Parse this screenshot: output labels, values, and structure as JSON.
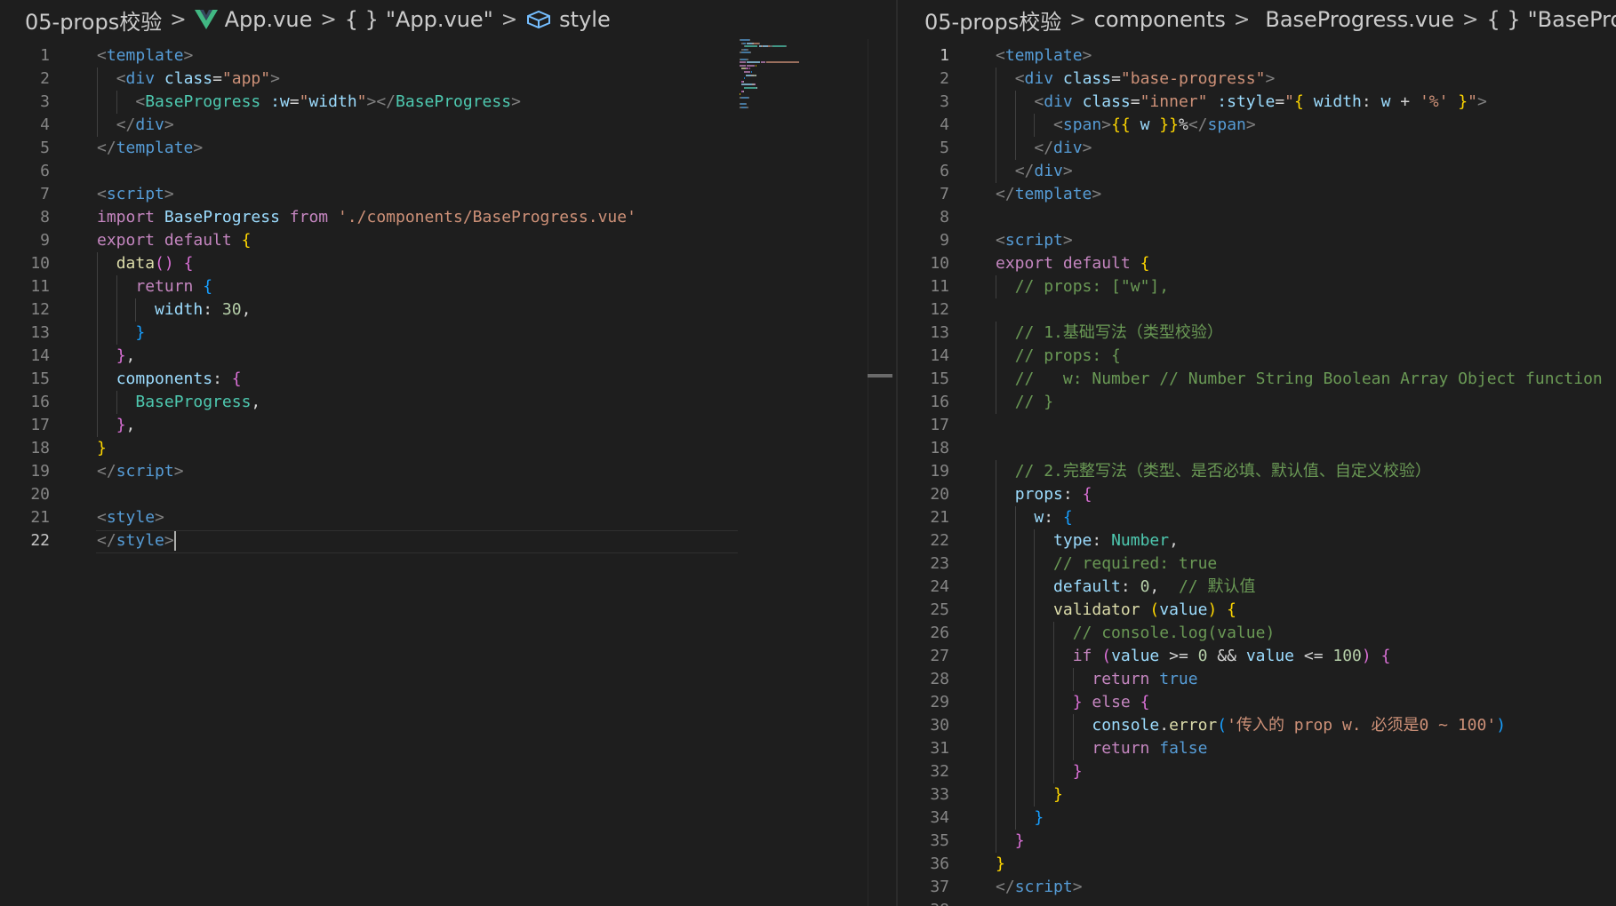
{
  "left_editor": {
    "breadcrumb": {
      "folder": "05-props校验",
      "file": "App.vue",
      "object": "\"App.vue\"",
      "symbol": "style"
    },
    "active_line": 22,
    "lines": [
      [
        {
          "c": "t-punct",
          "t": "<"
        },
        {
          "c": "t-tag",
          "t": "template"
        },
        {
          "c": "t-punct",
          "t": ">"
        }
      ],
      [
        {
          "c": "t-plain",
          "t": "  "
        },
        {
          "c": "t-punct",
          "t": "<"
        },
        {
          "c": "t-tag",
          "t": "div"
        },
        {
          "c": "t-plain",
          "t": " "
        },
        {
          "c": "t-attr",
          "t": "class"
        },
        {
          "c": "t-plain",
          "t": "="
        },
        {
          "c": "t-str",
          "t": "\"app\""
        },
        {
          "c": "t-punct",
          "t": ">"
        }
      ],
      [
        {
          "c": "t-plain",
          "t": "    "
        },
        {
          "c": "t-punct",
          "t": "<"
        },
        {
          "c": "t-comp",
          "t": "BaseProgress"
        },
        {
          "c": "t-plain",
          "t": " "
        },
        {
          "c": "t-attr",
          "t": ":w"
        },
        {
          "c": "t-plain",
          "t": "="
        },
        {
          "c": "t-str",
          "t": "\""
        },
        {
          "c": "t-var",
          "t": "width"
        },
        {
          "c": "t-str",
          "t": "\""
        },
        {
          "c": "t-punct",
          "t": "></"
        },
        {
          "c": "t-comp",
          "t": "BaseProgress"
        },
        {
          "c": "t-punct",
          "t": ">"
        }
      ],
      [
        {
          "c": "t-plain",
          "t": "  "
        },
        {
          "c": "t-punct",
          "t": "</"
        },
        {
          "c": "t-tag",
          "t": "div"
        },
        {
          "c": "t-punct",
          "t": ">"
        }
      ],
      [
        {
          "c": "t-punct",
          "t": "</"
        },
        {
          "c": "t-tag",
          "t": "template"
        },
        {
          "c": "t-punct",
          "t": ">"
        }
      ],
      [],
      [
        {
          "c": "t-punct",
          "t": "<"
        },
        {
          "c": "t-tag",
          "t": "script"
        },
        {
          "c": "t-punct",
          "t": ">"
        }
      ],
      [
        {
          "c": "t-kw",
          "t": "import"
        },
        {
          "c": "t-plain",
          "t": " "
        },
        {
          "c": "t-var",
          "t": "BaseProgress"
        },
        {
          "c": "t-plain",
          "t": " "
        },
        {
          "c": "t-kw",
          "t": "from"
        },
        {
          "c": "t-plain",
          "t": " "
        },
        {
          "c": "t-str",
          "t": "'./components/BaseProgress.vue'"
        }
      ],
      [
        {
          "c": "t-kw",
          "t": "export"
        },
        {
          "c": "t-plain",
          "t": " "
        },
        {
          "c": "t-kw",
          "t": "default"
        },
        {
          "c": "t-plain",
          "t": " "
        },
        {
          "c": "t-b1",
          "t": "{"
        }
      ],
      [
        {
          "c": "t-plain",
          "t": "  "
        },
        {
          "c": "t-fn",
          "t": "data"
        },
        {
          "c": "t-b2",
          "t": "()"
        },
        {
          "c": "t-plain",
          "t": " "
        },
        {
          "c": "t-b2",
          "t": "{"
        }
      ],
      [
        {
          "c": "t-plain",
          "t": "    "
        },
        {
          "c": "t-kw",
          "t": "return"
        },
        {
          "c": "t-plain",
          "t": " "
        },
        {
          "c": "t-b3",
          "t": "{"
        }
      ],
      [
        {
          "c": "t-plain",
          "t": "      "
        },
        {
          "c": "t-var",
          "t": "width"
        },
        {
          "c": "t-plain",
          "t": ": "
        },
        {
          "c": "t-num",
          "t": "30"
        },
        {
          "c": "t-plain",
          "t": ","
        }
      ],
      [
        {
          "c": "t-plain",
          "t": "    "
        },
        {
          "c": "t-b3",
          "t": "}"
        }
      ],
      [
        {
          "c": "t-plain",
          "t": "  "
        },
        {
          "c": "t-b2",
          "t": "}"
        },
        {
          "c": "t-plain",
          "t": ","
        }
      ],
      [
        {
          "c": "t-plain",
          "t": "  "
        },
        {
          "c": "t-var",
          "t": "components"
        },
        {
          "c": "t-plain",
          "t": ": "
        },
        {
          "c": "t-b2",
          "t": "{"
        }
      ],
      [
        {
          "c": "t-plain",
          "t": "    "
        },
        {
          "c": "t-comp",
          "t": "BaseProgress"
        },
        {
          "c": "t-plain",
          "t": ","
        }
      ],
      [
        {
          "c": "t-plain",
          "t": "  "
        },
        {
          "c": "t-b2",
          "t": "}"
        },
        {
          "c": "t-plain",
          "t": ","
        }
      ],
      [
        {
          "c": "t-b1",
          "t": "}"
        }
      ],
      [
        {
          "c": "t-punct",
          "t": "</"
        },
        {
          "c": "t-tag",
          "t": "script"
        },
        {
          "c": "t-punct",
          "t": ">"
        }
      ],
      [],
      [
        {
          "c": "t-punct",
          "t": "<"
        },
        {
          "c": "t-tag",
          "t": "style"
        },
        {
          "c": "t-punct",
          "t": ">"
        }
      ],
      [
        {
          "c": "t-punct",
          "t": "</"
        },
        {
          "c": "t-tag",
          "t": "style"
        },
        {
          "c": "t-punct",
          "t": ">"
        }
      ]
    ]
  },
  "right_editor": {
    "breadcrumb": {
      "folder": "05-props校验",
      "subfolder": "components",
      "file": "BaseProgress.vue",
      "object": "\"BasePro"
    },
    "active_line": 1,
    "lines": [
      [
        {
          "c": "t-punct",
          "t": "<"
        },
        {
          "c": "t-tag",
          "t": "template"
        },
        {
          "c": "t-punct",
          "t": ">"
        }
      ],
      [
        {
          "c": "t-plain",
          "t": "  "
        },
        {
          "c": "t-punct",
          "t": "<"
        },
        {
          "c": "t-tag",
          "t": "div"
        },
        {
          "c": "t-plain",
          "t": " "
        },
        {
          "c": "t-attr",
          "t": "class"
        },
        {
          "c": "t-plain",
          "t": "="
        },
        {
          "c": "t-str",
          "t": "\"base-progress\""
        },
        {
          "c": "t-punct",
          "t": ">"
        }
      ],
      [
        {
          "c": "t-plain",
          "t": "    "
        },
        {
          "c": "t-punct",
          "t": "<"
        },
        {
          "c": "t-tag",
          "t": "div"
        },
        {
          "c": "t-plain",
          "t": " "
        },
        {
          "c": "t-attr",
          "t": "class"
        },
        {
          "c": "t-plain",
          "t": "="
        },
        {
          "c": "t-str",
          "t": "\"inner\""
        },
        {
          "c": "t-plain",
          "t": " "
        },
        {
          "c": "t-attr",
          "t": ":style"
        },
        {
          "c": "t-plain",
          "t": "="
        },
        {
          "c": "t-str",
          "t": "\""
        },
        {
          "c": "t-b1",
          "t": "{"
        },
        {
          "c": "t-plain",
          "t": " "
        },
        {
          "c": "t-var",
          "t": "width"
        },
        {
          "c": "t-plain",
          "t": ": "
        },
        {
          "c": "t-var",
          "t": "w"
        },
        {
          "c": "t-plain",
          "t": " + "
        },
        {
          "c": "t-str",
          "t": "'%'"
        },
        {
          "c": "t-plain",
          "t": " "
        },
        {
          "c": "t-b1",
          "t": "}"
        },
        {
          "c": "t-str",
          "t": "\""
        },
        {
          "c": "t-punct",
          "t": ">"
        }
      ],
      [
        {
          "c": "t-plain",
          "t": "      "
        },
        {
          "c": "t-punct",
          "t": "<"
        },
        {
          "c": "t-tag",
          "t": "span"
        },
        {
          "c": "t-punct",
          "t": ">"
        },
        {
          "c": "t-b1",
          "t": "{{"
        },
        {
          "c": "t-plain",
          "t": " "
        },
        {
          "c": "t-var",
          "t": "w"
        },
        {
          "c": "t-plain",
          "t": " "
        },
        {
          "c": "t-b1",
          "t": "}}"
        },
        {
          "c": "t-plain",
          "t": "%"
        },
        {
          "c": "t-punct",
          "t": "</"
        },
        {
          "c": "t-tag",
          "t": "span"
        },
        {
          "c": "t-punct",
          "t": ">"
        }
      ],
      [
        {
          "c": "t-plain",
          "t": "    "
        },
        {
          "c": "t-punct",
          "t": "</"
        },
        {
          "c": "t-tag",
          "t": "div"
        },
        {
          "c": "t-punct",
          "t": ">"
        }
      ],
      [
        {
          "c": "t-plain",
          "t": "  "
        },
        {
          "c": "t-punct",
          "t": "</"
        },
        {
          "c": "t-tag",
          "t": "div"
        },
        {
          "c": "t-punct",
          "t": ">"
        }
      ],
      [
        {
          "c": "t-punct",
          "t": "</"
        },
        {
          "c": "t-tag",
          "t": "template"
        },
        {
          "c": "t-punct",
          "t": ">"
        }
      ],
      [],
      [
        {
          "c": "t-punct",
          "t": "<"
        },
        {
          "c": "t-tag",
          "t": "script"
        },
        {
          "c": "t-punct",
          "t": ">"
        }
      ],
      [
        {
          "c": "t-kw",
          "t": "export"
        },
        {
          "c": "t-plain",
          "t": " "
        },
        {
          "c": "t-kw",
          "t": "default"
        },
        {
          "c": "t-plain",
          "t": " "
        },
        {
          "c": "t-b1",
          "t": "{"
        }
      ],
      [
        {
          "c": "t-plain",
          "t": "  "
        },
        {
          "c": "t-com",
          "t": "// props: [\"w\"],"
        }
      ],
      [],
      [
        {
          "c": "t-plain",
          "t": "  "
        },
        {
          "c": "t-com",
          "t": "// 1.基础写法（类型校验）"
        }
      ],
      [
        {
          "c": "t-plain",
          "t": "  "
        },
        {
          "c": "t-com",
          "t": "// props: {"
        }
      ],
      [
        {
          "c": "t-plain",
          "t": "  "
        },
        {
          "c": "t-com",
          "t": "//   w: Number // Number String Boolean Array Object function"
        }
      ],
      [
        {
          "c": "t-plain",
          "t": "  "
        },
        {
          "c": "t-com",
          "t": "// }"
        }
      ],
      [],
      [],
      [
        {
          "c": "t-plain",
          "t": "  "
        },
        {
          "c": "t-com",
          "t": "// 2.完整写法（类型、是否必填、默认值、自定义校验）"
        }
      ],
      [
        {
          "c": "t-plain",
          "t": "  "
        },
        {
          "c": "t-var",
          "t": "props"
        },
        {
          "c": "t-plain",
          "t": ": "
        },
        {
          "c": "t-b2",
          "t": "{"
        }
      ],
      [
        {
          "c": "t-plain",
          "t": "    "
        },
        {
          "c": "t-var",
          "t": "w"
        },
        {
          "c": "t-plain",
          "t": ": "
        },
        {
          "c": "t-b3",
          "t": "{"
        }
      ],
      [
        {
          "c": "t-plain",
          "t": "      "
        },
        {
          "c": "t-var",
          "t": "type"
        },
        {
          "c": "t-plain",
          "t": ": "
        },
        {
          "c": "t-comp",
          "t": "Number"
        },
        {
          "c": "t-plain",
          "t": ","
        }
      ],
      [
        {
          "c": "t-plain",
          "t": "      "
        },
        {
          "c": "t-com",
          "t": "// required: true"
        }
      ],
      [
        {
          "c": "t-plain",
          "t": "      "
        },
        {
          "c": "t-var",
          "t": "default"
        },
        {
          "c": "t-plain",
          "t": ": "
        },
        {
          "c": "t-num",
          "t": "0"
        },
        {
          "c": "t-plain",
          "t": ",  "
        },
        {
          "c": "t-com",
          "t": "// 默认值"
        }
      ],
      [
        {
          "c": "t-plain",
          "t": "      "
        },
        {
          "c": "t-fn",
          "t": "validator"
        },
        {
          "c": "t-plain",
          "t": " "
        },
        {
          "c": "t-b1",
          "t": "("
        },
        {
          "c": "t-var",
          "t": "value"
        },
        {
          "c": "t-b1",
          "t": ")"
        },
        {
          "c": "t-plain",
          "t": " "
        },
        {
          "c": "t-b1",
          "t": "{"
        }
      ],
      [
        {
          "c": "t-plain",
          "t": "        "
        },
        {
          "c": "t-com",
          "t": "// console.log(value)"
        }
      ],
      [
        {
          "c": "t-plain",
          "t": "        "
        },
        {
          "c": "t-kw",
          "t": "if"
        },
        {
          "c": "t-plain",
          "t": " "
        },
        {
          "c": "t-b2",
          "t": "("
        },
        {
          "c": "t-var",
          "t": "value"
        },
        {
          "c": "t-plain",
          "t": " >= "
        },
        {
          "c": "t-num",
          "t": "0"
        },
        {
          "c": "t-plain",
          "t": " && "
        },
        {
          "c": "t-var",
          "t": "value"
        },
        {
          "c": "t-plain",
          "t": " <= "
        },
        {
          "c": "t-num",
          "t": "100"
        },
        {
          "c": "t-b2",
          "t": ")"
        },
        {
          "c": "t-plain",
          "t": " "
        },
        {
          "c": "t-b2",
          "t": "{"
        }
      ],
      [
        {
          "c": "t-plain",
          "t": "          "
        },
        {
          "c": "t-kw",
          "t": "return"
        },
        {
          "c": "t-plain",
          "t": " "
        },
        {
          "c": "t-blue",
          "t": "true"
        }
      ],
      [
        {
          "c": "t-plain",
          "t": "        "
        },
        {
          "c": "t-b2",
          "t": "}"
        },
        {
          "c": "t-plain",
          "t": " "
        },
        {
          "c": "t-kw",
          "t": "else"
        },
        {
          "c": "t-plain",
          "t": " "
        },
        {
          "c": "t-b2",
          "t": "{"
        }
      ],
      [
        {
          "c": "t-plain",
          "t": "          "
        },
        {
          "c": "t-var",
          "t": "console"
        },
        {
          "c": "t-plain",
          "t": "."
        },
        {
          "c": "t-fn",
          "t": "error"
        },
        {
          "c": "t-b3",
          "t": "("
        },
        {
          "c": "t-str",
          "t": "'传入的 prop w. 必须是0 ~ 100'"
        },
        {
          "c": "t-b3",
          "t": ")"
        }
      ],
      [
        {
          "c": "t-plain",
          "t": "          "
        },
        {
          "c": "t-kw",
          "t": "return"
        },
        {
          "c": "t-plain",
          "t": " "
        },
        {
          "c": "t-blue",
          "t": "false"
        }
      ],
      [
        {
          "c": "t-plain",
          "t": "        "
        },
        {
          "c": "t-b2",
          "t": "}"
        }
      ],
      [
        {
          "c": "t-plain",
          "t": "      "
        },
        {
          "c": "t-b1",
          "t": "}"
        }
      ],
      [
        {
          "c": "t-plain",
          "t": "    "
        },
        {
          "c": "t-b3",
          "t": "}"
        }
      ],
      [
        {
          "c": "t-plain",
          "t": "  "
        },
        {
          "c": "t-b2",
          "t": "}"
        }
      ],
      [
        {
          "c": "t-b1",
          "t": "}"
        }
      ],
      [
        {
          "c": "t-punct",
          "t": "</"
        },
        {
          "c": "t-tag",
          "t": "script"
        },
        {
          "c": "t-punct",
          "t": ">"
        }
      ],
      []
    ]
  },
  "colors": {
    "background": "#1e1e1e",
    "vue_green": "#41b883",
    "line_number": "#858585",
    "active_line_number": "#c6c6c6"
  },
  "icons": {
    "vue": "vue-logo-icon",
    "json_object": "braces-icon",
    "style_symbol": "style-symbol-icon",
    "separator": "chevron-right-icon"
  }
}
